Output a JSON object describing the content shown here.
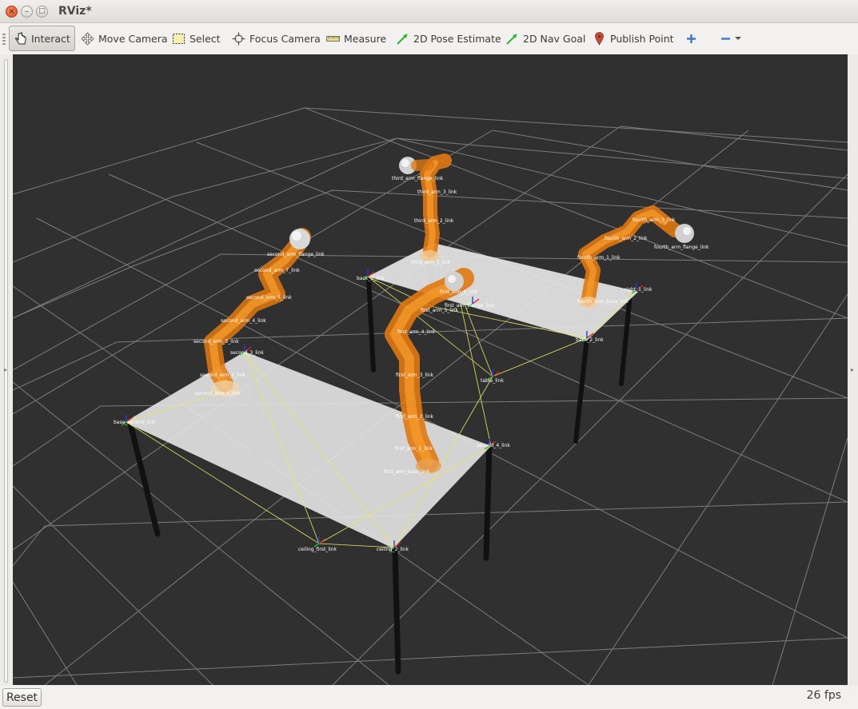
{
  "window": {
    "title": "RViz*",
    "close_symbol": "×",
    "minimize_symbol": "–",
    "maximize_symbol": "□"
  },
  "toolbar": {
    "tools": [
      {
        "label": "Interact",
        "icon": "hand-pointer-icon",
        "active": true
      },
      {
        "label": "Move Camera",
        "icon": "move-arrows-icon",
        "active": false
      },
      {
        "label": "Select",
        "icon": "select-box-icon",
        "active": false
      },
      {
        "label": "Focus Camera",
        "icon": "focus-crosshair-icon",
        "active": false
      },
      {
        "label": "Measure",
        "icon": "ruler-icon",
        "active": false
      },
      {
        "label": "2D Pose Estimate",
        "icon": "green-arrow-icon",
        "active": false
      },
      {
        "label": "2D Nav Goal",
        "icon": "green-arrow-icon",
        "active": false
      },
      {
        "label": "Publish Point",
        "icon": "map-pin-icon",
        "active": false
      }
    ],
    "add_tool_icon": "plus-icon",
    "remove_tool_icon": "minus-icon",
    "menu_icon": "chevron-down-icon"
  },
  "viewport": {
    "background": "#303030",
    "frame_labels": {
      "table_left_corner": "base_second_link",
      "table_front_left": "ceiling_first_link",
      "table_front_right": "ceiling_2_link",
      "table_right_corner": "second_4_link",
      "table_mid_corner": "second_3_link",
      "second_arm_1": "second_arm_1_link",
      "second_arm_2": "second_arm_2_link",
      "second_arm_3": "second_arm_3_link",
      "second_arm_4": "second_arm_4_link",
      "second_arm_5": "second_arm_5_link",
      "second_arm_7": "second_arm_7_link",
      "second_arm_ee": "second_arm_flange_link",
      "first_arm_1": "first_arm_1_link",
      "first_arm_2": "first_arm_2_link",
      "first_arm_3": "first_arm_3_link",
      "first_arm_4": "first_arm_4_link",
      "first_arm_5": "first_arm_5_link",
      "first_arm_6": "first_arm_6_link",
      "first_arm_ee": "first_arm_flange_link",
      "first_base": "first_arm_base_link",
      "center_link": "table_link",
      "third_arm_1": "third_arm_1_link",
      "third_arm_2": "third_arm_2_link",
      "third_arm_3": "third_arm_3_link",
      "third_arm_ee": "third_arm_flange_link",
      "back_table_left": "back_1_link",
      "back_table_right": "back_2_link",
      "right_table_corner": "right_1_link",
      "right_arm_1": "fourth_arm_1_link",
      "right_arm_2": "fourth_arm_2_link",
      "right_arm_3": "fourth_arm_3_link",
      "right_arm_ee": "fourth_arm_flange_link",
      "right_arm_base": "fourth_arm_base_link"
    }
  },
  "statusbar": {
    "reset_label": "Reset",
    "fps": "26 fps"
  }
}
